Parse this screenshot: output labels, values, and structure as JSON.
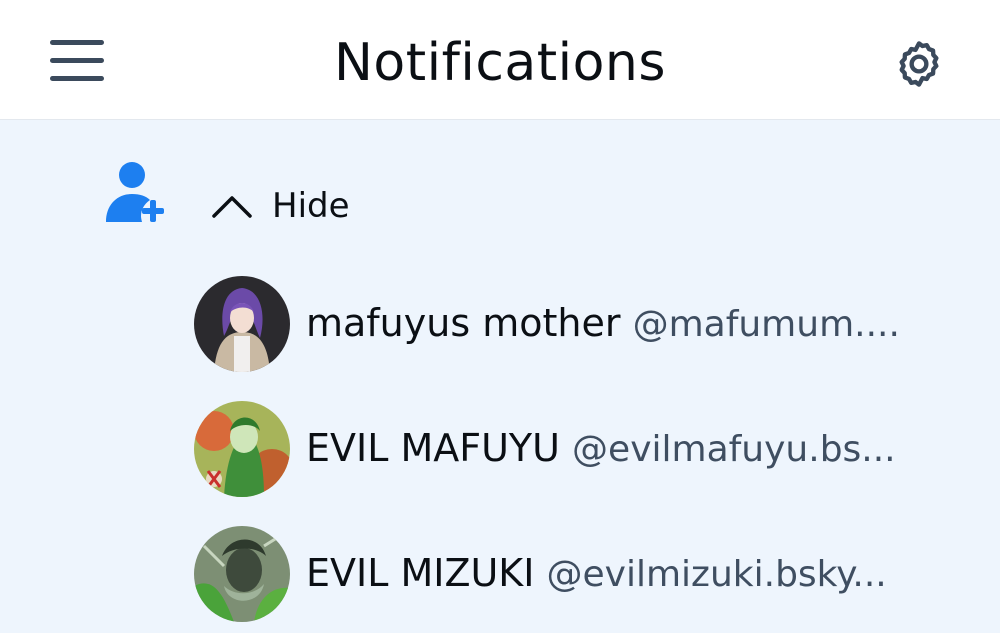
{
  "header": {
    "title": "Notifications",
    "menu_icon": "hamburger-menu-icon",
    "settings_icon": "gear-icon"
  },
  "notification": {
    "type_icon": "person-plus-icon",
    "toggle_icon": "chevron-up-icon",
    "toggle_label": "Hide",
    "accent_color": "#1d7ff0"
  },
  "followers": [
    {
      "display_name": "mafuyus mother",
      "handle": "@mafumum...."
    },
    {
      "display_name": "EVIL MAFUYU",
      "handle": "@evilmafuyu.bs..."
    },
    {
      "display_name": "EVIL MIZUKI",
      "handle": "@evilmizuki.bsky..."
    }
  ],
  "colors": {
    "header_bg": "#ffffff",
    "content_bg": "#eef5fd",
    "text": "#0b0f14",
    "handle_text": "#3f4e61",
    "icon_gray": "#3b4a5c"
  }
}
